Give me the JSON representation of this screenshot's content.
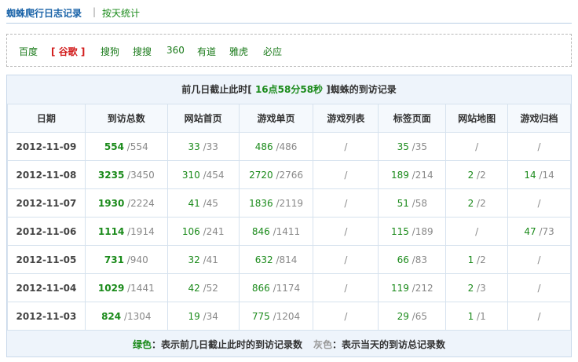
{
  "header": {
    "title": "蜘蛛爬行日志记录",
    "separator": "|",
    "sub_link": "按天统计"
  },
  "engines": [
    {
      "label": "百度",
      "active": false
    },
    {
      "label": "[ 谷歌 ]",
      "active": true
    },
    {
      "label": "搜狗",
      "active": false
    },
    {
      "label": "搜搜",
      "active": false
    },
    {
      "label": "360",
      "active": false
    },
    {
      "label": "有道",
      "active": false
    },
    {
      "label": "雅虎",
      "active": false
    },
    {
      "label": "必应",
      "active": false
    }
  ],
  "caption": {
    "prefix": "前几日截止此时[",
    "time": " 16点58分58秒 ",
    "suffix": "]蜘蛛的到访记录"
  },
  "columns": [
    "日期",
    "到访总数",
    "网站首页",
    "游戏单页",
    "游戏列表",
    "标签页面",
    "网站地图",
    "游戏归档"
  ],
  "rows": [
    {
      "date": "2012-11-09",
      "cells": [
        [
          "554",
          "/554"
        ],
        [
          "33",
          "/33"
        ],
        [
          "486",
          "/486"
        ],
        [
          "",
          "/"
        ],
        [
          "35",
          "/35"
        ],
        [
          "",
          "/"
        ],
        [
          "",
          "/"
        ]
      ]
    },
    {
      "date": "2012-11-08",
      "cells": [
        [
          "3235",
          "/3450"
        ],
        [
          "310",
          "/454"
        ],
        [
          "2720",
          "/2766"
        ],
        [
          "",
          "/"
        ],
        [
          "189",
          "/214"
        ],
        [
          "2",
          "/2"
        ],
        [
          "14",
          "/14"
        ]
      ]
    },
    {
      "date": "2012-11-07",
      "cells": [
        [
          "1930",
          "/2224"
        ],
        [
          "41",
          "/45"
        ],
        [
          "1836",
          "/2119"
        ],
        [
          "",
          "/"
        ],
        [
          "51",
          "/58"
        ],
        [
          "2",
          "/2"
        ],
        [
          "",
          "/"
        ]
      ]
    },
    {
      "date": "2012-11-06",
      "cells": [
        [
          "1114",
          "/1914"
        ],
        [
          "106",
          "/241"
        ],
        [
          "846",
          "/1411"
        ],
        [
          "",
          "/"
        ],
        [
          "115",
          "/189"
        ],
        [
          "",
          "/"
        ],
        [
          "47",
          "/73"
        ]
      ]
    },
    {
      "date": "2012-11-05",
      "cells": [
        [
          "731",
          "/940"
        ],
        [
          "32",
          "/41"
        ],
        [
          "632",
          "/814"
        ],
        [
          "",
          "/"
        ],
        [
          "66",
          "/83"
        ],
        [
          "1",
          "/2"
        ],
        [
          "",
          "/"
        ]
      ]
    },
    {
      "date": "2012-11-04",
      "cells": [
        [
          "1029",
          "/1441"
        ],
        [
          "42",
          "/52"
        ],
        [
          "866",
          "/1174"
        ],
        [
          "",
          "/"
        ],
        [
          "119",
          "/212"
        ],
        [
          "2",
          "/3"
        ],
        [
          "",
          "/"
        ]
      ]
    },
    {
      "date": "2012-11-03",
      "cells": [
        [
          "824",
          "/1304"
        ],
        [
          "19",
          "/34"
        ],
        [
          "775",
          "/1204"
        ],
        [
          "",
          "/"
        ],
        [
          "29",
          "/65"
        ],
        [
          "1",
          "/1"
        ],
        [
          "",
          "/"
        ]
      ]
    }
  ],
  "legend": {
    "green_word": "绿色",
    "green_text": "：表示前几日截止此时的到访记录数",
    "gray_word": "灰色",
    "gray_text": "：表示当天的到访总记录数"
  },
  "colors": {
    "green": "#1a8a1a",
    "gray": "#888888",
    "red": "#d21c1c",
    "title_blue": "#1a63a8"
  }
}
